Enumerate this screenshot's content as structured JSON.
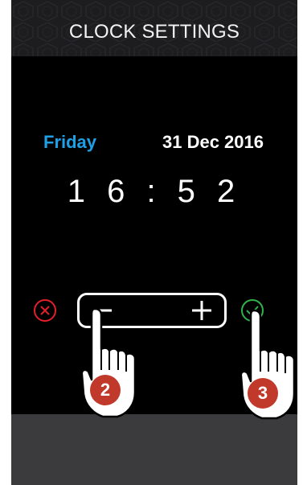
{
  "header": {
    "title": "CLOCK SETTINGS"
  },
  "clock": {
    "day": "Friday",
    "date": "31 Dec 2016",
    "time": "1 6 : 5 2"
  },
  "controls": {
    "cancel_icon": "circle-x-icon",
    "confirm_icon": "circle-check-icon",
    "minus_icon": "minus-icon",
    "plus_icon": "plus-icon"
  },
  "steps": {
    "step_one": "2",
    "step_two": "3"
  },
  "colors": {
    "day_accent": "#1ea0e6",
    "cancel": "#e0202a",
    "confirm": "#2fb34a",
    "badge": "#c0392b",
    "footer": "#3b3b3d",
    "header": "#1d1d1f"
  }
}
